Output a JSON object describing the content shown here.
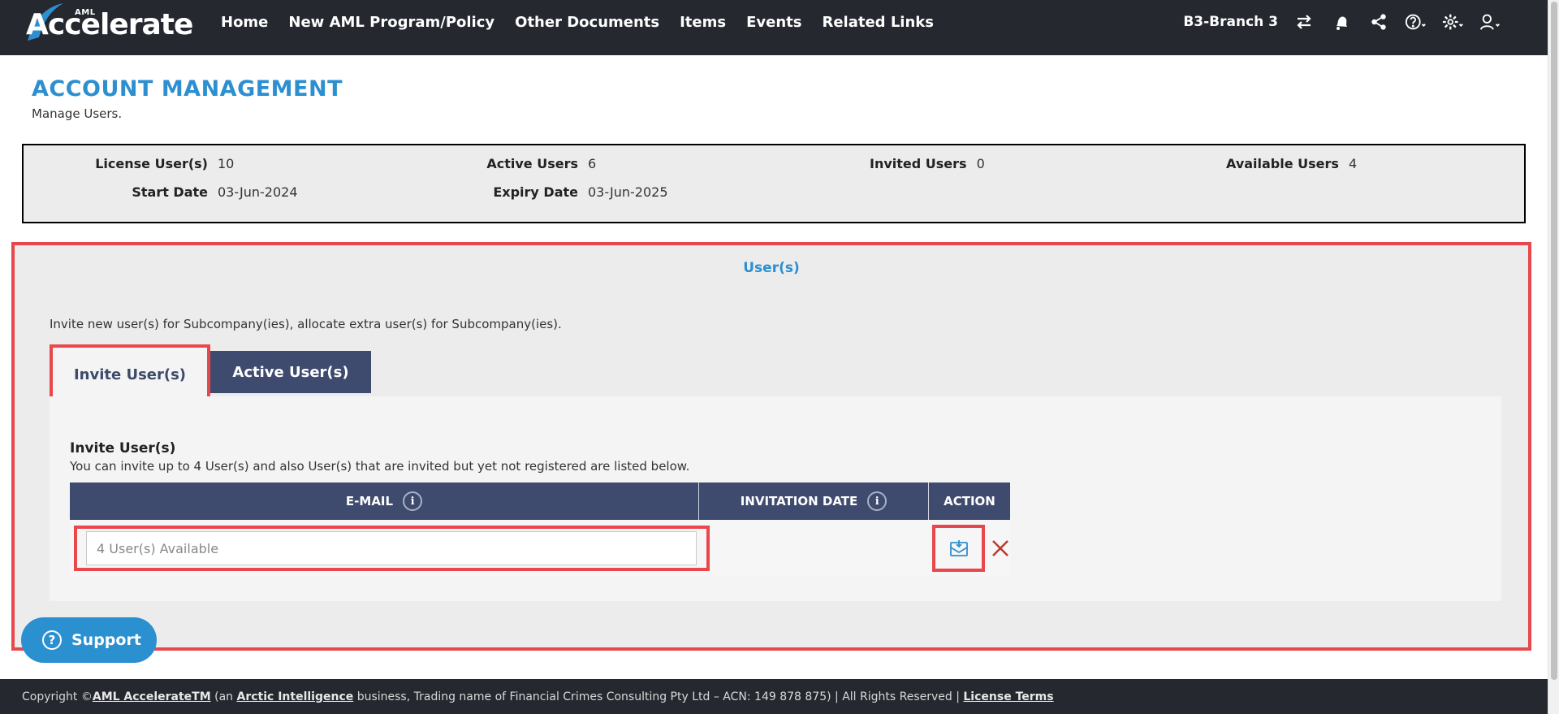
{
  "nav": {
    "logo_small": "AML",
    "logo_brand": "Accelerate",
    "items": [
      "Home",
      "New AML Program/Policy",
      "Other Documents",
      "Items",
      "Events",
      "Related Links"
    ],
    "branch": "B3-Branch 3",
    "icons": [
      "switch-icon",
      "bell-icon",
      "share-icon",
      "help-icon",
      "gear-icon",
      "user-icon"
    ]
  },
  "header": {
    "title": "ACCOUNT MANAGEMENT",
    "subtitle": "Manage Users."
  },
  "summary": {
    "license_label": "License User(s)",
    "license_value": "10",
    "active_label": "Active Users",
    "active_value": "6",
    "invited_label": "Invited Users",
    "invited_value": "0",
    "available_label": "Available Users",
    "available_value": "4",
    "start_label": "Start Date",
    "start_value": "03-Jun-2024",
    "expiry_label": "Expiry Date",
    "expiry_value": "03-Jun-2025"
  },
  "users": {
    "title": "User(s)",
    "description": "Invite new user(s) for Subcompany(ies), allocate extra user(s) for Subcompany(ies).",
    "tab_invite": "Invite User(s)",
    "tab_active": "Active User(s)",
    "invite_title": "Invite User(s)",
    "invite_desc": "You can invite up to 4 User(s) and also User(s) that are invited but yet not registered are listed below.",
    "col_email": "E-MAIL",
    "col_date": "INVITATION DATE",
    "col_action": "ACTION",
    "info_glyph": "i",
    "email_placeholder": "4 User(s) Available"
  },
  "support": {
    "label": "Support",
    "glyph": "?"
  },
  "footer": {
    "prefix": "Copyright © ",
    "brand_link": "AML AccelerateTM",
    "mid1": " (an ",
    "ai_link": "Arctic Intelligence",
    "mid2": " business, Trading name of Financial Crimes Consulting Pty Ltd – ACN: 149 878 875) | All Rights Reserved | ",
    "terms_link": "License Terms"
  },
  "colors": {
    "navy": "#3f4b6e",
    "accent_blue": "#2d8fd0",
    "highlight_red": "#e8474c",
    "topbar": "#25282f"
  }
}
